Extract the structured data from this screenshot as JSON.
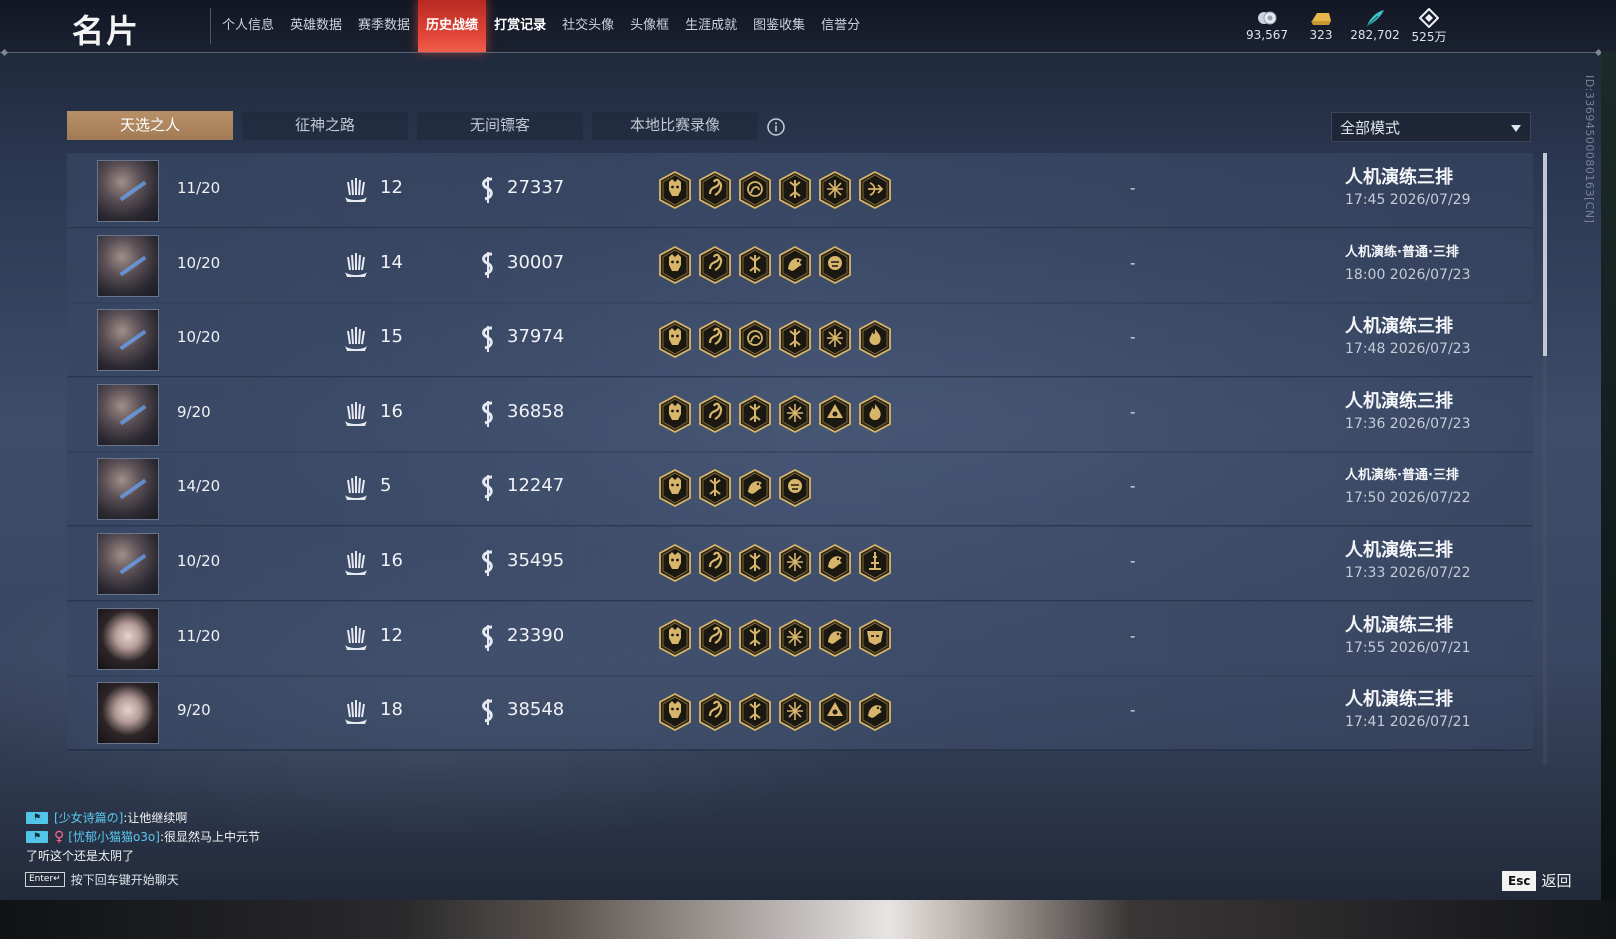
{
  "header": {
    "title": "名片",
    "nav": [
      {
        "label": "个人信息",
        "state": "normal"
      },
      {
        "label": "英雄数据",
        "state": "normal"
      },
      {
        "label": "赛季数据",
        "state": "normal"
      },
      {
        "label": "历史战绩",
        "state": "active"
      },
      {
        "label": "打赏记录",
        "state": "bold"
      },
      {
        "label": "社交头像",
        "state": "normal"
      },
      {
        "label": "头像框",
        "state": "normal"
      },
      {
        "label": "生涯成就",
        "state": "normal"
      },
      {
        "label": "图鉴收集",
        "state": "normal"
      },
      {
        "label": "信誉分",
        "state": "normal"
      }
    ],
    "currencies": [
      {
        "icon": "coins-icon",
        "value": "93,567"
      },
      {
        "icon": "gold-ingot-icon",
        "value": "323"
      },
      {
        "icon": "feather-icon",
        "value": "282,702"
      },
      {
        "icon": "diamond-icon",
        "value": "525万"
      }
    ],
    "player_id": "ID:3369450008016З[CN]"
  },
  "tabs": [
    "天选之人",
    "征神之路",
    "无间镖客",
    "本地比赛录像"
  ],
  "mode_select": "全部模式",
  "matches": [
    {
      "avatar": "male",
      "placement": "11/20",
      "kills": "12",
      "damage": "27337",
      "badges": [
        "oni",
        "dragon",
        "swirl",
        "rune",
        "star",
        "bow"
      ],
      "mode": "人机演练三排",
      "mode_size": "large",
      "time": "17:45  2026/07/29",
      "extra": "-"
    },
    {
      "avatar": "male",
      "placement": "10/20",
      "kills": "14",
      "damage": "30007",
      "badges": [
        "oni",
        "dragon",
        "rune",
        "beast",
        "lion"
      ],
      "mode": "人机演练·普通·三排",
      "mode_size": "small",
      "time": "18:00  2026/07/23",
      "extra": "-"
    },
    {
      "avatar": "male",
      "placement": "10/20",
      "kills": "15",
      "damage": "37974",
      "badges": [
        "oni",
        "dragon",
        "swirl",
        "rune",
        "star",
        "flame"
      ],
      "mode": "人机演练三排",
      "mode_size": "large",
      "time": "17:48  2026/07/23",
      "extra": "-"
    },
    {
      "avatar": "male",
      "placement": "9/20",
      "kills": "16",
      "damage": "36858",
      "badges": [
        "oni",
        "dragon",
        "rune",
        "star",
        "tri",
        "flame"
      ],
      "mode": "人机演练三排",
      "mode_size": "large",
      "time": "17:36  2026/07/23",
      "extra": "-"
    },
    {
      "avatar": "male",
      "placement": "14/20",
      "kills": "5",
      "damage": "12247",
      "badges": [
        "oni",
        "rune",
        "beast",
        "lion"
      ],
      "mode": "人机演练·普通·三排",
      "mode_size": "small",
      "time": "17:50  2026/07/22",
      "extra": "-"
    },
    {
      "avatar": "male",
      "placement": "10/20",
      "kills": "16",
      "damage": "35495",
      "badges": [
        "oni",
        "dragon",
        "rune",
        "star",
        "beast",
        "tower"
      ],
      "mode": "人机演练三排",
      "mode_size": "large",
      "time": "17:33  2026/07/22",
      "extra": "-"
    },
    {
      "avatar": "female",
      "placement": "11/20",
      "kills": "12",
      "damage": "23390",
      "badges": [
        "oni",
        "dragon",
        "rune",
        "star",
        "beast",
        "mask"
      ],
      "mode": "人机演练三排",
      "mode_size": "large",
      "time": "17:55  2026/07/21",
      "extra": "-"
    },
    {
      "avatar": "female",
      "placement": "9/20",
      "kills": "18",
      "damage": "38548",
      "badges": [
        "oni",
        "dragon",
        "rune",
        "star",
        "tri",
        "beast"
      ],
      "mode": "人机演练三排",
      "mode_size": "large",
      "time": "17:41  2026/07/21",
      "extra": "-"
    }
  ],
  "chat": {
    "messages": [
      {
        "tag": "组队",
        "name": "[少女诗篇の]",
        "text": ":让他继续啊",
        "female": false
      },
      {
        "tag": "组队",
        "name": "[忧郁小猫猫o3o]",
        "text": ":很显然马上中元节",
        "female": true
      },
      {
        "tag": "",
        "name": "",
        "text": "了听这个还是太阴了",
        "female": false
      }
    ],
    "enter_key": "Enter↵",
    "hint": "按下回车键开始聊天"
  },
  "footer": {
    "esc_key": "Esc",
    "back_label": "返回"
  },
  "colors": {
    "accent_active_tab": "#e2473a",
    "selected_subtab": "#b89067",
    "badge_gold": "#d7b56a",
    "chat_name": "#58c8ee"
  }
}
